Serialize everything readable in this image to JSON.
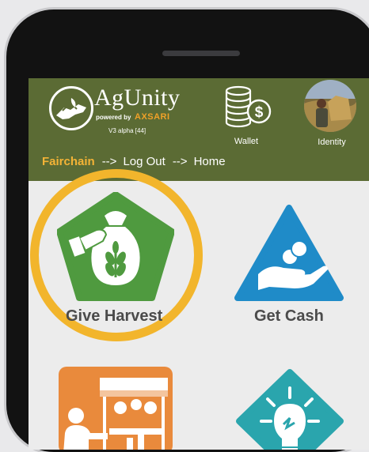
{
  "header": {
    "app_name": "AgUnity",
    "powered_by": "powered by",
    "brand": "AXSARI",
    "version": "V3 alpha [44]",
    "wallet_label": "Wallet",
    "identity_label": "Identity"
  },
  "breadcrumb": {
    "items": [
      "Fairchain",
      "Log Out",
      "Home"
    ],
    "separator": "-->"
  },
  "tiles": [
    {
      "label": "Give Harvest",
      "icon": "harvest-bag-icon",
      "color": "#4f9a3f",
      "highlighted": true
    },
    {
      "label": "Get Cash",
      "icon": "cash-hand-icon",
      "color": "#1f8bc8"
    },
    {
      "label": "",
      "icon": "market-stall-icon",
      "color": "#e98a3c"
    },
    {
      "label": "",
      "icon": "lightbulb-icon",
      "color": "#2aa5ad"
    }
  ],
  "colors": {
    "header_bg": "#5b6b34",
    "accent": "#f4b336",
    "highlight_ring": "#f2b52c"
  }
}
